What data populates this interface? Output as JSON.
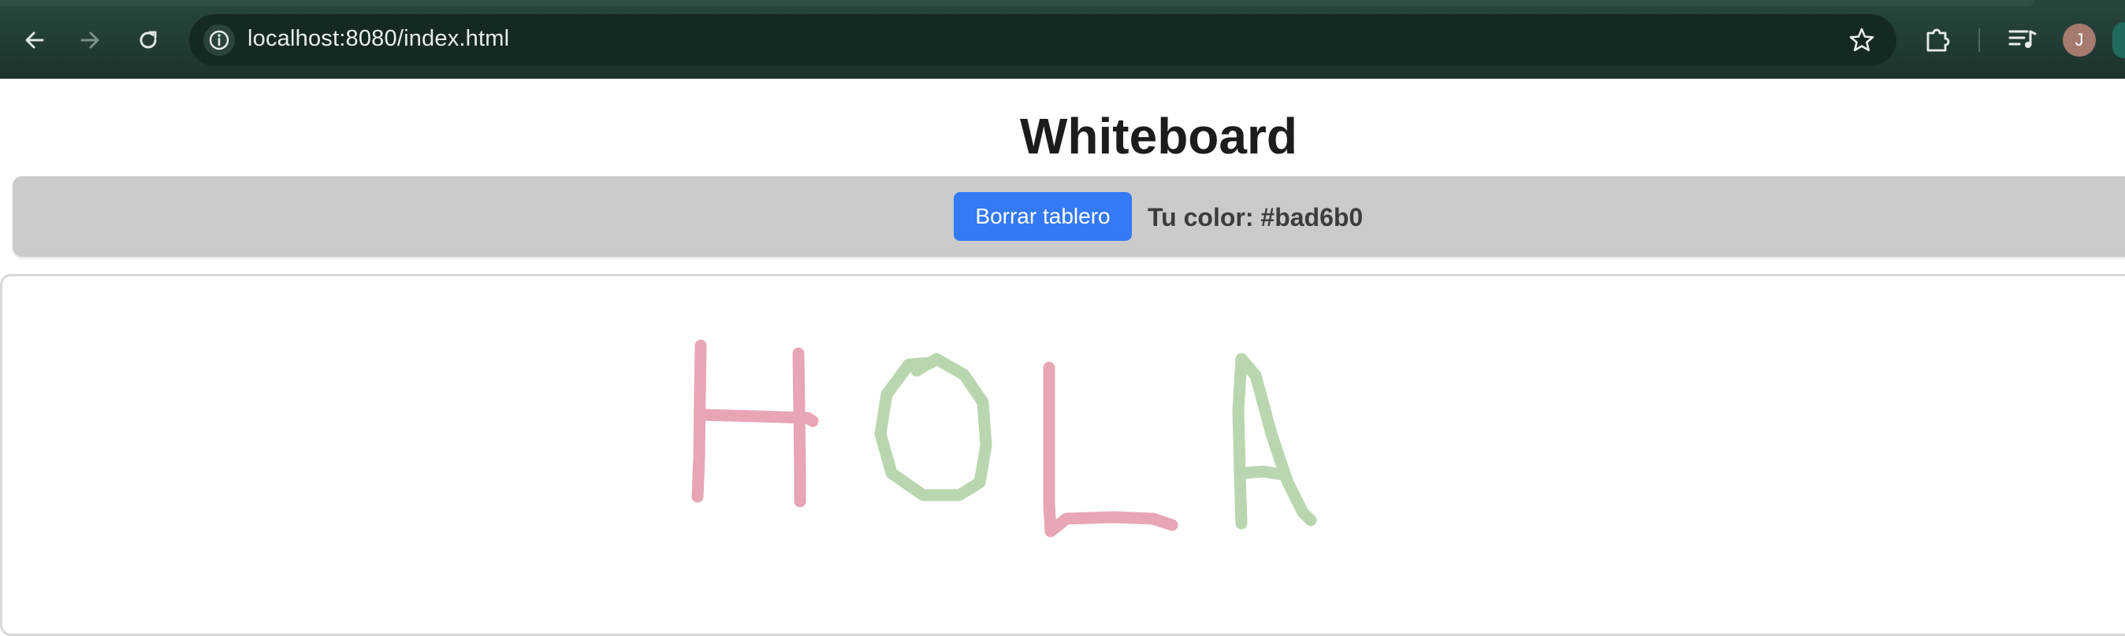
{
  "browser": {
    "url": "localhost:8080/index.html",
    "avatar_initial": "J"
  },
  "page": {
    "title": "Whiteboard",
    "clear_button_label": "Borrar tablero",
    "color_label": "Tu color: #bad6b0"
  },
  "colors": {
    "pink_stroke": "#e8a5b6",
    "green_stroke": "#bad6b0",
    "button": "#3479f6",
    "toolbar": "#cbcbcb"
  },
  "icons": [
    "back-arrow-icon",
    "forward-arrow-icon",
    "reload-icon",
    "site-info-icon",
    "star-icon",
    "extensions-icon",
    "media-controls-icon"
  ]
}
